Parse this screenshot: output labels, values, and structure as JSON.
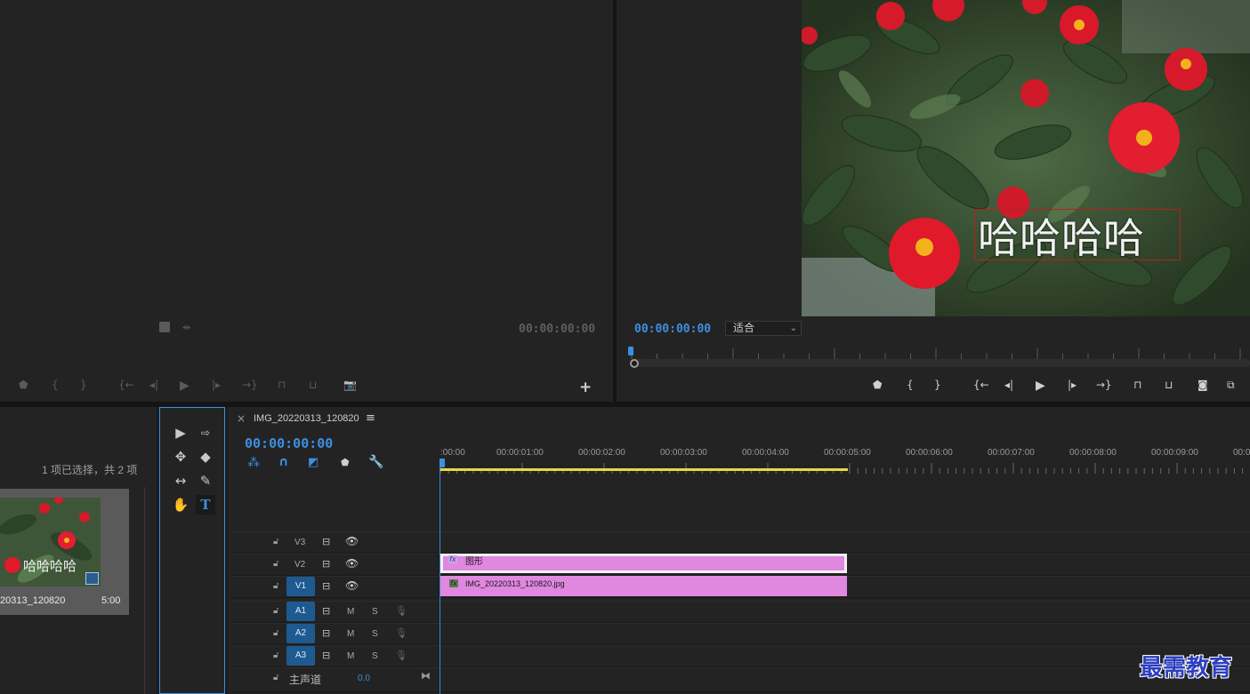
{
  "source_monitor": {
    "timecode": "00:00:00:00",
    "buttons": [
      {
        "name": "add-marker-icon",
        "glyph": "⬟"
      },
      {
        "name": "mark-in-icon",
        "glyph": "{"
      },
      {
        "name": "mark-out-icon",
        "glyph": "}"
      },
      {
        "name": "go-to-in-icon",
        "glyph": "{←"
      },
      {
        "name": "step-back-icon",
        "glyph": "◂|"
      },
      {
        "name": "play-icon",
        "glyph": "▶"
      },
      {
        "name": "step-forward-icon",
        "glyph": "|▸"
      },
      {
        "name": "go-to-out-icon",
        "glyph": "→}"
      },
      {
        "name": "insert-icon",
        "glyph": "⊓"
      },
      {
        "name": "overwrite-icon",
        "glyph": "⊔"
      },
      {
        "name": "camera-icon",
        "glyph": "📷"
      }
    ],
    "add_button": "+"
  },
  "program_monitor": {
    "timecode": "00:00:00:00",
    "fit_select": "适合",
    "overlay_text": "哈哈哈哈",
    "buttons": [
      {
        "name": "add-marker-icon",
        "glyph": "⬟"
      },
      {
        "name": "mark-in-icon",
        "glyph": "{"
      },
      {
        "name": "mark-out-icon",
        "glyph": "}"
      },
      {
        "name": "go-to-in-icon",
        "glyph": "{←"
      },
      {
        "name": "step-back-icon",
        "glyph": "◂|"
      },
      {
        "name": "play-icon",
        "glyph": "▶"
      },
      {
        "name": "step-forward-icon",
        "glyph": "|▸"
      },
      {
        "name": "go-to-out-icon",
        "glyph": "→}"
      },
      {
        "name": "lift-icon",
        "glyph": "⊓"
      },
      {
        "name": "extract-icon",
        "glyph": "⊔"
      },
      {
        "name": "camera-icon",
        "glyph": "◙"
      },
      {
        "name": "comparison-icon",
        "glyph": "⧉"
      }
    ]
  },
  "project": {
    "selection_status": "1 项已选择，共 2 项",
    "item": {
      "thumb_text": "哈哈哈哈",
      "name": "20313_120820",
      "duration": "5:00"
    }
  },
  "timeline": {
    "tab_close": "×",
    "sequence_name": "IMG_20220313_120820",
    "menu_icon": "≡",
    "timecode": "00:00:00:00",
    "ruler_labels": [
      ":00:00",
      "00:00:01:00",
      "00:00:02:00",
      "00:00:03:00",
      "00:00:04:00",
      "00:00:05:00",
      "00:00:06:00",
      "00:00:07:00",
      "00:00:08:00",
      "00:00:09:00",
      "00:0"
    ],
    "video_tracks": [
      {
        "id": "V3",
        "source": "",
        "active": false
      },
      {
        "id": "V2",
        "source": "",
        "active": false
      },
      {
        "id": "V1",
        "source": "V1",
        "active": true
      }
    ],
    "audio_tracks": [
      {
        "id": "A1",
        "source": "A1",
        "m": "M",
        "s": "S"
      },
      {
        "id": "A2",
        "source": "A2",
        "m": "M",
        "s": "S"
      },
      {
        "id": "A3",
        "source": "A3",
        "m": "M",
        "s": "S"
      }
    ],
    "master": {
      "label": "主声道",
      "value": "0.0"
    },
    "clips": {
      "graphic": {
        "fx": "fx",
        "label": "图形"
      },
      "image": {
        "fx": "fx",
        "label": "IMG_20220313_120820.jpg"
      }
    }
  },
  "watermark": "最需教育",
  "colors": {
    "clip": "#e087e0",
    "accent": "#3d8fe0",
    "work_area": "#e8d84a",
    "track_active": "#1e5a8f"
  }
}
